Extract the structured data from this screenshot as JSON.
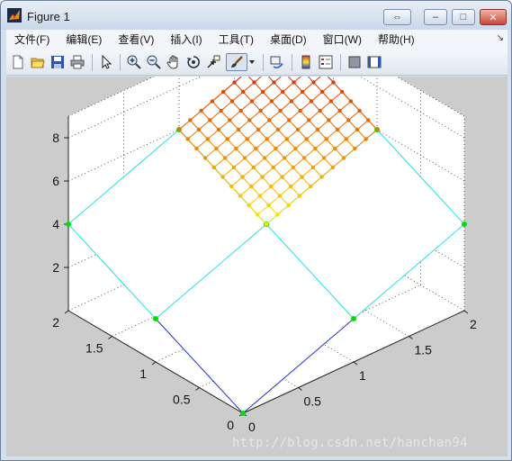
{
  "window": {
    "title": "Figure 1",
    "buttons": {
      "restore": "⇔",
      "minimize": "–",
      "maximize": "□",
      "close": "✕"
    }
  },
  "menu": [
    {
      "label": "文件(F)"
    },
    {
      "label": "编辑(E)"
    },
    {
      "label": "查看(V)"
    },
    {
      "label": "插入(I)"
    },
    {
      "label": "工具(T)"
    },
    {
      "label": "桌面(D)"
    },
    {
      "label": "窗口(W)"
    },
    {
      "label": "帮助(H)"
    }
  ],
  "toolbar": [
    {
      "name": "new-figure-icon"
    },
    {
      "name": "open-file-icon"
    },
    {
      "name": "save-icon"
    },
    {
      "name": "print-icon"
    },
    {
      "name": "edit-plot-icon"
    },
    {
      "name": "zoom-in-icon"
    },
    {
      "name": "zoom-out-icon"
    },
    {
      "name": "pan-icon"
    },
    {
      "name": "rotate-3d-icon"
    },
    {
      "name": "data-cursor-icon"
    },
    {
      "name": "brush-icon"
    },
    {
      "name": "link-plot-icon"
    },
    {
      "name": "colorbar-icon"
    },
    {
      "name": "legend-icon"
    },
    {
      "name": "hide-plot-tools-icon"
    },
    {
      "name": "show-plot-tools-icon"
    }
  ],
  "chart_data": {
    "type": "3d-mesh",
    "x_ticks": [
      "0",
      "0.5",
      "1",
      "1.5",
      "2"
    ],
    "y_ticks": [
      "0",
      "0.5",
      "1",
      "1.5",
      "2"
    ],
    "z_ticks": [
      "2",
      "4",
      "6",
      "8"
    ],
    "xlim": [
      0,
      2
    ],
    "ylim": [
      0,
      2
    ],
    "zlim": [
      0,
      9
    ],
    "grid": true,
    "coarse_surface": {
      "x": [
        0,
        1,
        2
      ],
      "y": [
        0,
        1,
        2
      ],
      "z": [
        [
          0,
          2,
          4
        ],
        [
          2,
          4,
          6
        ],
        [
          4,
          6,
          8
        ]
      ]
    },
    "fine_surface": {
      "x_range": [
        1,
        2
      ],
      "y_range": [
        1,
        2
      ],
      "steps": 11,
      "z_formula": "2*(x+y)"
    },
    "colors": {
      "coarse_low": "#1f2fd0",
      "coarse_mid": "#22e1e1",
      "coarse_high": "#e07a1a",
      "coarse_marker": "#00e000",
      "fine_low": "#ffea00",
      "fine_high": "#d40000"
    }
  },
  "watermark": "http://blog.csdn.net/hanchan94"
}
